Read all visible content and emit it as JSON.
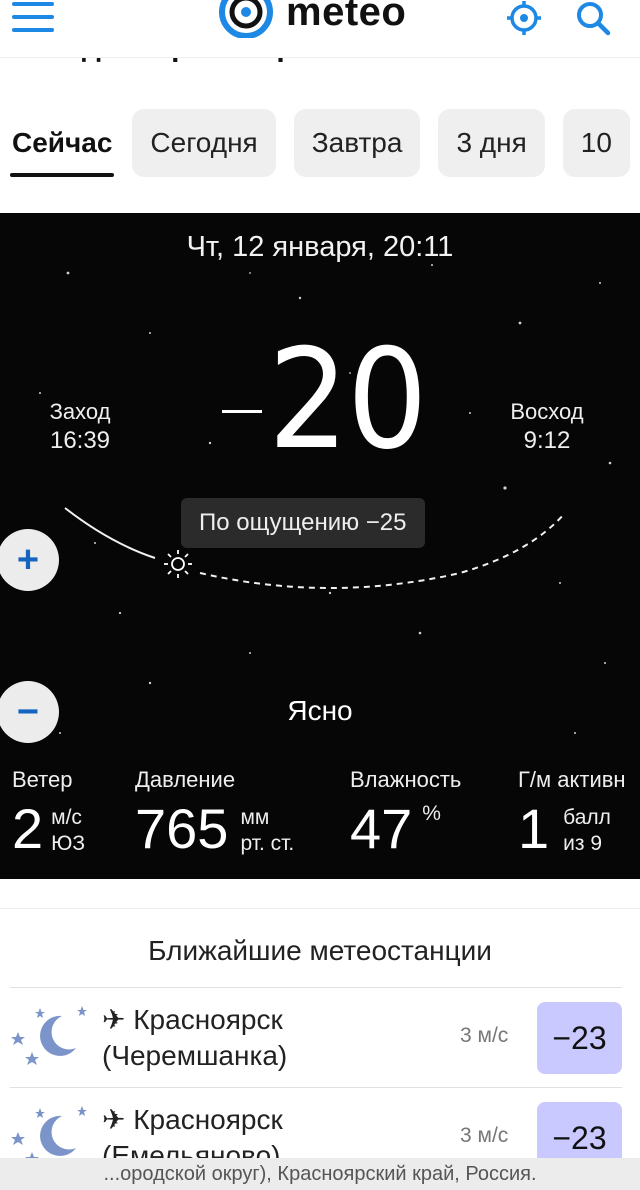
{
  "header": {
    "logo_text": "meteo",
    "page_heading": "Погода в Красноярске сейчас",
    "brand_color": "#1e88e5"
  },
  "tabs": [
    {
      "label": "Сейчас",
      "active": true
    },
    {
      "label": "Сегодня",
      "active": false
    },
    {
      "label": "Завтра",
      "active": false
    },
    {
      "label": "3 дня",
      "active": false
    },
    {
      "label": "10",
      "active": false
    }
  ],
  "current": {
    "datetime": "Чт, 12 января, 20:11",
    "temperature": "20",
    "feels_like": "По ощущению −25",
    "sunset_label": "Заход",
    "sunset_time": "16:39",
    "sunrise_label": "Восход",
    "sunrise_time": "9:12",
    "condition": "Ясно"
  },
  "zoom": {
    "plus": "+",
    "minus": "−"
  },
  "stats": {
    "wind": {
      "label": "Ветер",
      "value": "2",
      "unit1": "м/с",
      "unit2": "ЮЗ"
    },
    "pressure": {
      "label": "Давление",
      "value": "765",
      "unit1": "мм",
      "unit2": "рт. ст."
    },
    "humidity": {
      "label": "Влажность",
      "value": "47",
      "unit1": "%",
      "unit2": ""
    },
    "geomagnetic": {
      "label": "Г/м активн",
      "value": "1",
      "unit1": "балл",
      "unit2": "из 9"
    }
  },
  "stations": {
    "title": "Ближайшие метеостанции",
    "items": [
      {
        "name_line1": "✈ Красноярск",
        "name_line2": "(Черемшанка)",
        "wind": "3 м/с",
        "temp": "−23"
      },
      {
        "name_line1": "✈ Красноярск",
        "name_line2": "(Емельяново)",
        "wind": "3 м/с",
        "temp": "−23"
      }
    ]
  },
  "footer": {
    "text": "...ородской округ), Красноярский край, Россия."
  },
  "colors": {
    "night_bg": "#060606",
    "temp_badge": "#c9c9ff",
    "zoom_icon": "#1565c0"
  }
}
